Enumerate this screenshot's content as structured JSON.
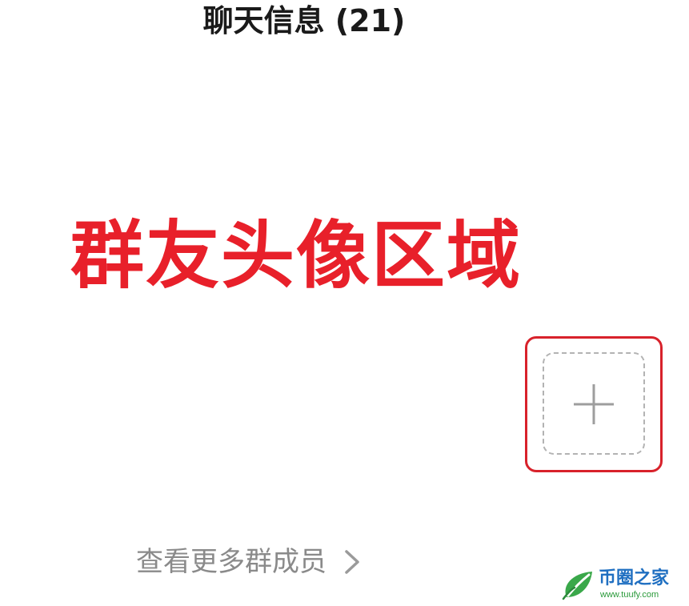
{
  "header": {
    "title": "聊天信息 (21)"
  },
  "annotation": {
    "text": "群友头像区域",
    "color": "#e8202a"
  },
  "members": {
    "add_button_icon": "plus-icon"
  },
  "more_members": {
    "label": "查看更多群成员",
    "icon": "chevron-right-icon"
  },
  "watermark": {
    "name": "币圈之家",
    "url": "www.tuufy.com",
    "colors": {
      "name": "#1f6fc1",
      "url": "#2a9a3a",
      "leaf": "#3aa84a"
    }
  }
}
